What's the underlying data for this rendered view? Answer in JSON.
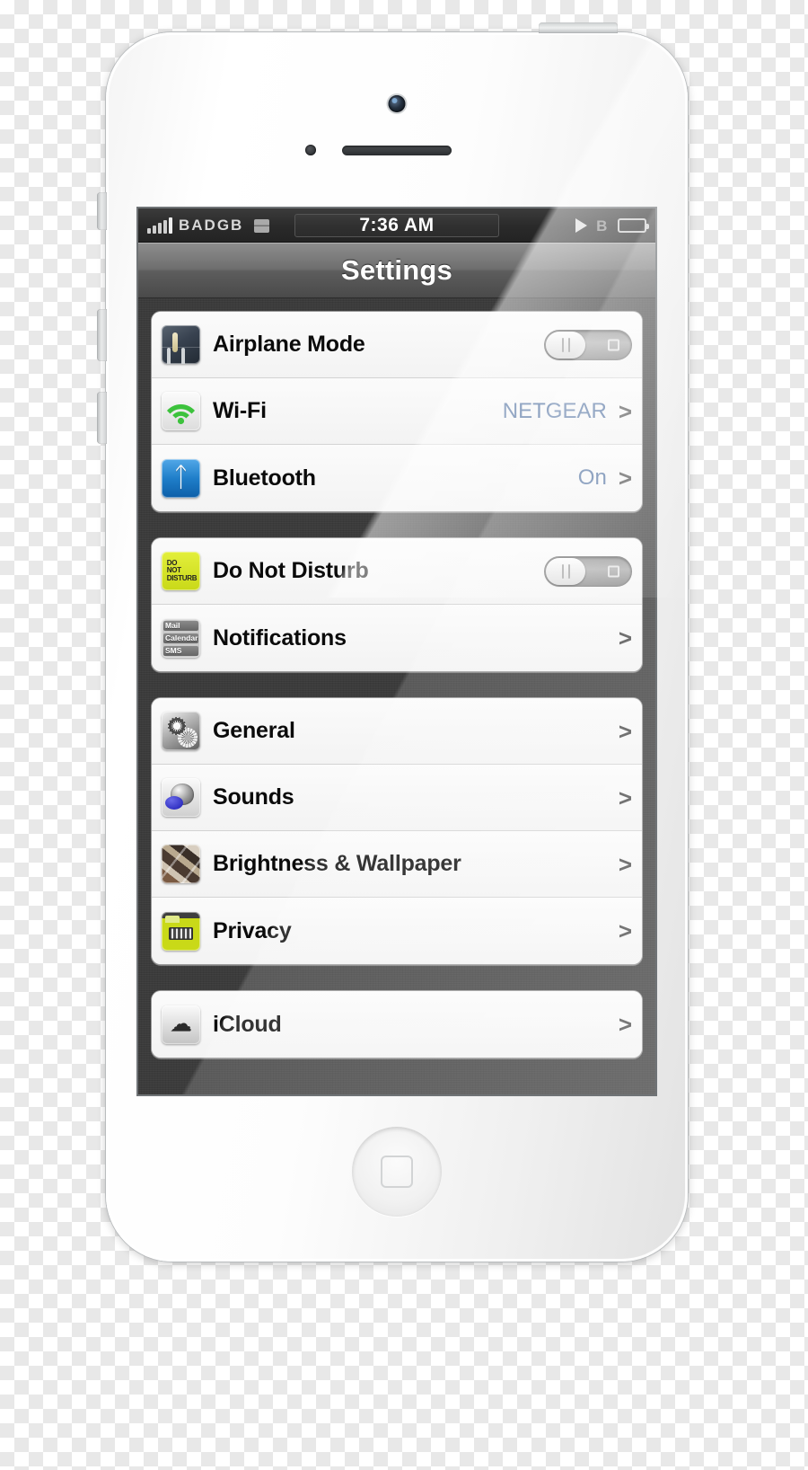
{
  "statusbar": {
    "carrier": "BADGB",
    "clock": "7:36 AM",
    "signal_bars": 5,
    "network_badge_icon": "network-badge-icon",
    "play_icon": "play-icon",
    "bluetooth_icon": "bluetooth-status-icon",
    "bluetooth_glyph": "B",
    "battery_icon": "battery-icon"
  },
  "navbar": {
    "title": "Settings"
  },
  "colors": {
    "value_blue": "#4a6b9c",
    "dnd_yellow": "#c9d918",
    "bluetooth_blue": "#1f7ec9",
    "wifi_green": "#3cc23c"
  },
  "groups": [
    {
      "rows": [
        {
          "label": "Airplane Mode",
          "icon": "airplane-mode-icon",
          "control": "switch",
          "switch_state": "off",
          "value": "",
          "chevron": ""
        },
        {
          "label": "Wi-Fi",
          "icon": "wifi-icon",
          "control": "disclosure",
          "value": "NETGEAR",
          "chevron": ">"
        },
        {
          "label": "Bluetooth",
          "icon": "bluetooth-icon",
          "control": "disclosure",
          "value": "On",
          "chevron": ">"
        }
      ]
    },
    {
      "rows": [
        {
          "label": "Do Not Disturb",
          "icon": "do-not-disturb-icon",
          "control": "switch",
          "switch_state": "off",
          "icon_text_lines": [
            "DO",
            "NOT",
            "DISTURB"
          ],
          "value": "",
          "chevron": ""
        },
        {
          "label": "Notifications",
          "icon": "notifications-icon",
          "control": "disclosure",
          "icon_text_lines": [
            "Mail",
            "Calendar",
            "SMS"
          ],
          "value": "",
          "chevron": ">"
        }
      ]
    },
    {
      "rows": [
        {
          "label": "General",
          "icon": "general-icon",
          "control": "disclosure",
          "value": "",
          "chevron": ">"
        },
        {
          "label": "Sounds",
          "icon": "sounds-icon",
          "control": "disclosure",
          "value": "",
          "chevron": ">"
        },
        {
          "label": "Brightness & Wallpaper",
          "icon": "brightness-wallpaper-icon",
          "control": "disclosure",
          "value": "",
          "chevron": ">"
        },
        {
          "label": "Privacy",
          "icon": "privacy-icon",
          "control": "disclosure",
          "value": "",
          "chevron": ">"
        }
      ]
    },
    {
      "rows": [
        {
          "label": "iCloud",
          "icon": "icloud-icon",
          "control": "disclosure",
          "icon_glyph": "☁",
          "value": "",
          "chevron": ">"
        }
      ]
    }
  ],
  "device": {
    "home_button": "home-button",
    "earpiece": "earpiece-speaker",
    "front_camera": "front-camera",
    "proximity_sensor": "proximity-sensor",
    "silent_switch": "silent-switch",
    "volume_up": "volume-up-button",
    "volume_down": "volume-down-button",
    "power_button": "power-button"
  }
}
